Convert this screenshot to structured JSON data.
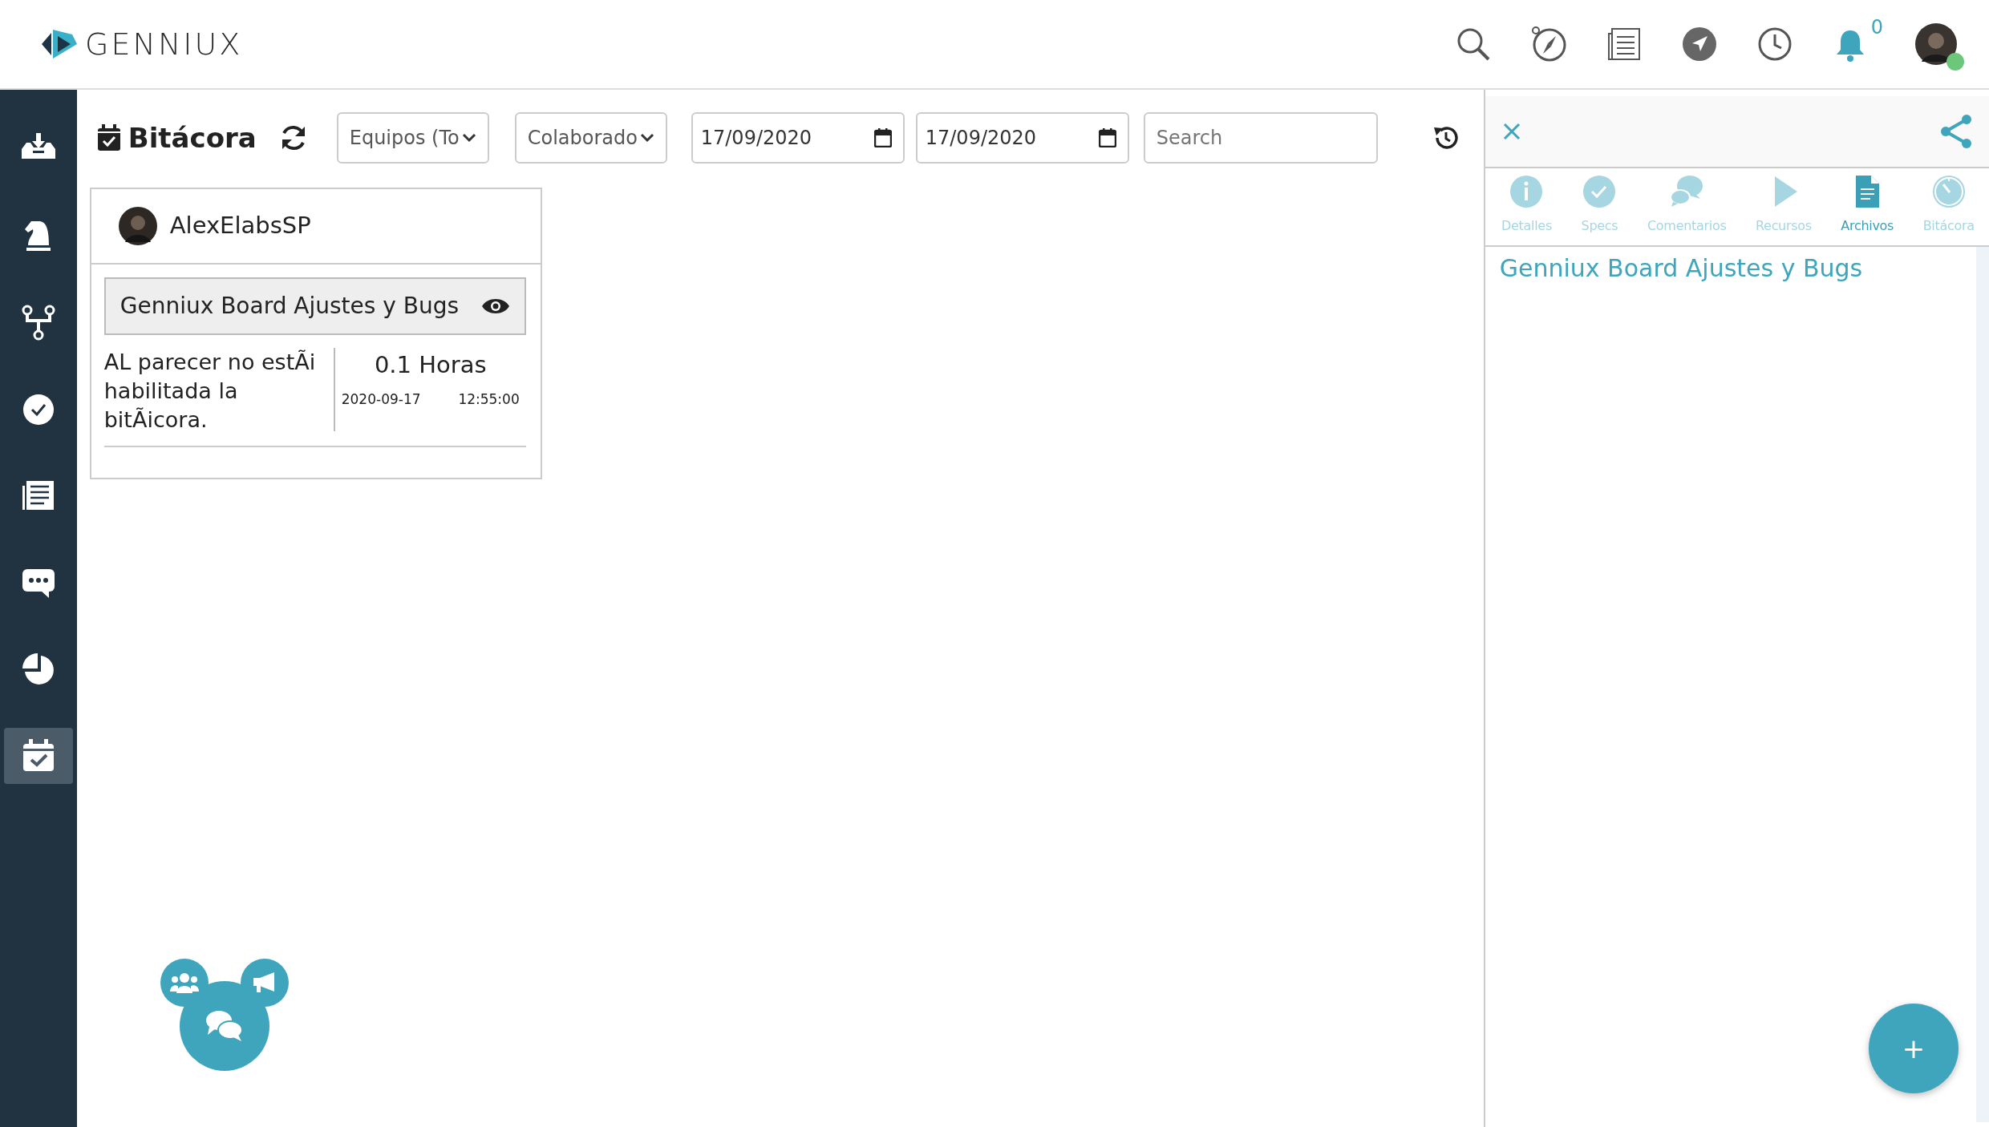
{
  "header": {
    "logo": "GENNIUX",
    "notification_count": "0"
  },
  "sidebar": {
    "items": [
      {
        "kind": "inbox",
        "selected": false
      },
      {
        "kind": "knight",
        "selected": false
      },
      {
        "kind": "fork",
        "selected": false
      },
      {
        "kind": "check",
        "selected": false
      },
      {
        "kind": "news",
        "selected": false
      },
      {
        "kind": "chat",
        "selected": false
      },
      {
        "kind": "pie",
        "selected": false
      },
      {
        "kind": "calendar",
        "selected": true
      }
    ]
  },
  "toolbar": {
    "title": "Bitácora",
    "filters": [
      {
        "value": "Equipos (To"
      },
      {
        "value": "Colaborado"
      }
    ],
    "dates": [
      "17/09/2020",
      "17/09/2020"
    ],
    "search": {
      "placeholder": "Search"
    }
  },
  "entries": [
    {
      "user": "AlexElabsSP",
      "project": "Genniux Board Ajustes y Bugs",
      "note": "AL parecer no estÃi habilitada la bitÃicora.",
      "hours": "0.1 Horas",
      "date": "2020-09-17",
      "time": "12:55:00"
    }
  ],
  "panel": {
    "tabs": [
      {
        "kind": "info",
        "label": "Detalles",
        "selected": false
      },
      {
        "kind": "check",
        "label": "Specs",
        "selected": false
      },
      {
        "kind": "comments",
        "label": "Comentarios",
        "selected": false
      },
      {
        "kind": "play",
        "label": "Recursos",
        "selected": false
      },
      {
        "kind": "file",
        "label": "Archivos",
        "selected": true
      },
      {
        "kind": "clock",
        "label": "Bitácora",
        "selected": false
      }
    ],
    "title": "Genniux Board Ajustes y Bugs",
    "add_button": "+"
  }
}
